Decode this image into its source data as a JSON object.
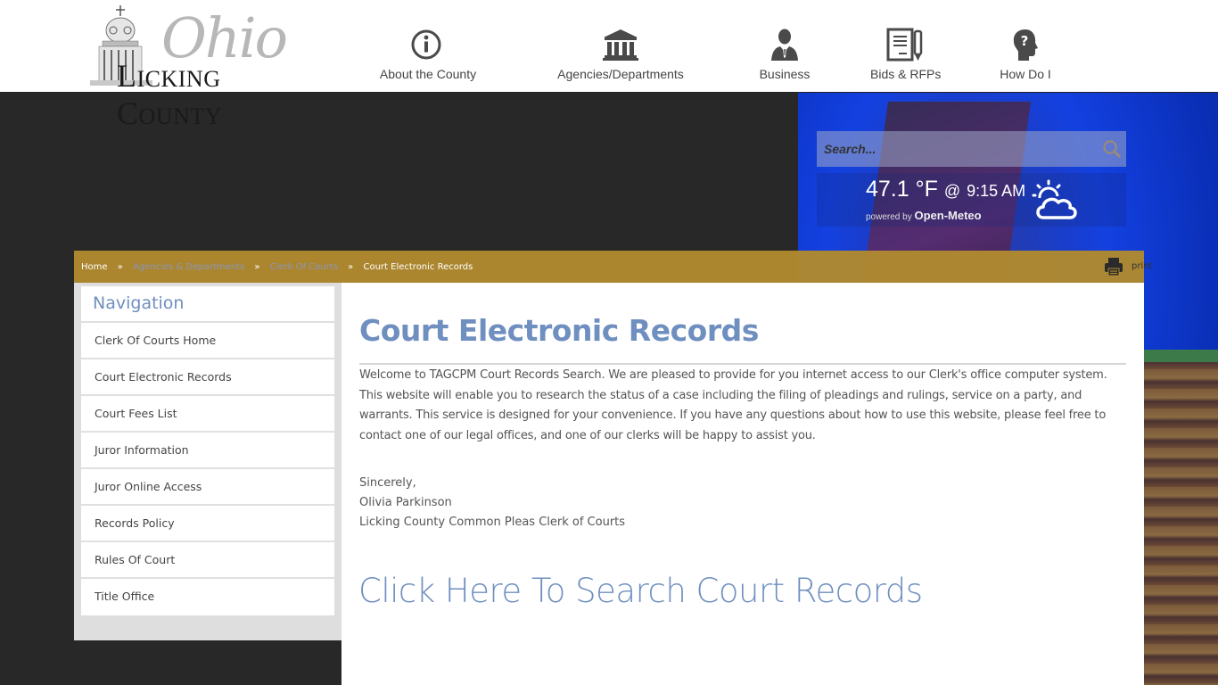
{
  "logo": {
    "script_text": "Ohio",
    "name_text": "Licking County",
    "name_initial_1": "L",
    "name_rest_1": "ICKING ",
    "name_initial_2": "C",
    "name_rest_2": "OUNTY"
  },
  "topnav": [
    {
      "label": "About the County",
      "icon": "info-icon"
    },
    {
      "label": "Agencies/Departments",
      "icon": "government-building-icon"
    },
    {
      "label": "Business",
      "icon": "businessman-icon"
    },
    {
      "label": "Bids & RFPs",
      "icon": "document-pen-icon"
    },
    {
      "label": "How Do I",
      "icon": "question-head-icon"
    }
  ],
  "search": {
    "placeholder": "Search...",
    "value": ""
  },
  "weather": {
    "temperature": "47.1 °F",
    "at": "@",
    "time": "9:15 AM",
    "powered_by": "powered by",
    "provider": "Open-Meteo",
    "condition_icon": "partly-cloudy-icon"
  },
  "breadcrumb": {
    "items": [
      "Home",
      "Agencies & Departments",
      "Clerk Of Courts",
      "Court Electronic Records"
    ],
    "separator": "»"
  },
  "print_label": "print",
  "sidebar": {
    "title": "Navigation",
    "items": [
      "Clerk Of Courts Home",
      "Court Electronic Records",
      "Court Fees List",
      "Juror Information",
      "Juror Online Access",
      "Records Policy",
      "Rules Of Court",
      "Title Office"
    ]
  },
  "main": {
    "title": "Court Electronic Records",
    "intro": "Welcome to TAGCPM Court Records Search. We are pleased to provide for you internet access to our Clerk's office computer system. This website will enable you to research the status of a case including the filing of pleadings and rulings, service on a party, and warrants. This service is designed for your convenience. If you have any questions about how to use this website, please feel free to contact one of our legal offices, and one of our clerks will be happy to assist you.",
    "signature": [
      "Sincerely,",
      "Olivia Parkinson",
      "Licking County Common Pleas Clerk of Courts"
    ],
    "search_link": "Click Here To Search Court Records"
  },
  "colors": {
    "accent_blue": "#6f8fc0",
    "breadcrumb_gold": "#af892f",
    "dark_bg": "#282828",
    "sidebar_bg": "#dedede"
  }
}
